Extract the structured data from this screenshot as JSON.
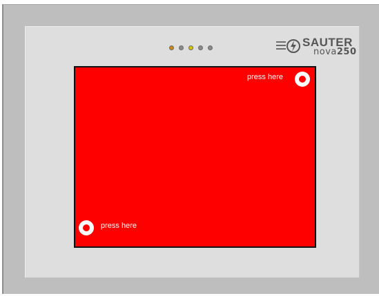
{
  "device": {
    "brand": "SAUTER",
    "model_prefix": "nova",
    "model_number": "250",
    "logo_icon": "sauter-logo-icon"
  },
  "status_leds": [
    {
      "name": "led-1",
      "color": "#c98a14"
    },
    {
      "name": "led-2",
      "color": "#8a8a8a"
    },
    {
      "name": "led-3",
      "color": "#d6c400"
    },
    {
      "name": "led-4",
      "color": "#8a8a8a"
    },
    {
      "name": "led-5",
      "color": "#8a8a8a"
    }
  ],
  "screen": {
    "background_color": "#ff0000",
    "targets": [
      {
        "id": "top-right",
        "label": "press here"
      },
      {
        "id": "bottom-left",
        "label": "press here"
      }
    ]
  }
}
